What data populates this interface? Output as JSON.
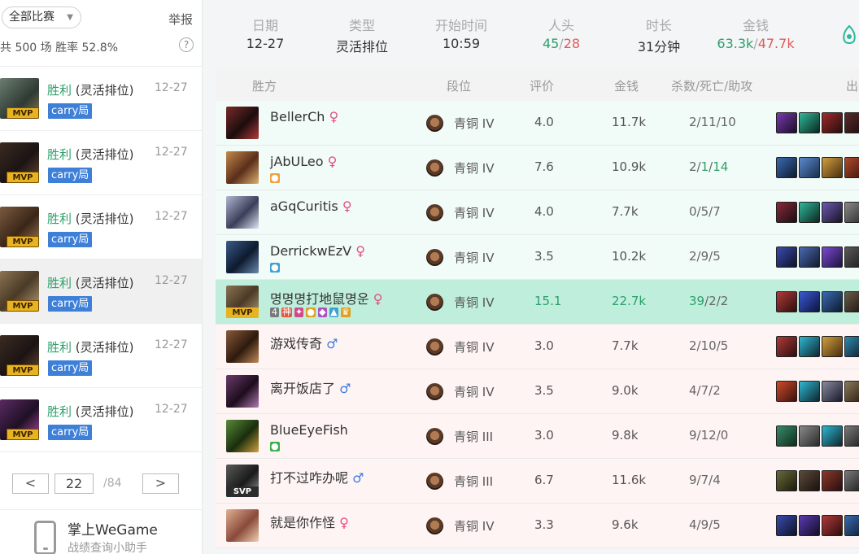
{
  "sidebar": {
    "filter_label": "全部比赛",
    "report_label": "举报",
    "summary": "共 500 场   胜率 52.8%",
    "help": "?",
    "matches": [
      {
        "result": "胜利",
        "mode": "(灵活排位)",
        "date": "12-27",
        "tag": "carry局",
        "badge": "MVP"
      },
      {
        "result": "胜利",
        "mode": "(灵活排位)",
        "date": "12-27",
        "tag": "carry局",
        "badge": "MVP"
      },
      {
        "result": "胜利",
        "mode": "(灵活排位)",
        "date": "12-27",
        "tag": "carry局",
        "badge": "MVP"
      },
      {
        "result": "胜利",
        "mode": "(灵活排位)",
        "date": "12-27",
        "tag": "carry局",
        "badge": "MVP"
      },
      {
        "result": "胜利",
        "mode": "(灵活排位)",
        "date": "12-27",
        "tag": "carry局",
        "badge": "MVP"
      },
      {
        "result": "胜利",
        "mode": "(灵活排位)",
        "date": "12-27",
        "tag": "carry局",
        "badge": "MVP"
      }
    ],
    "pager": {
      "prev": "<",
      "current": "22",
      "total": "/84",
      "next": ">"
    },
    "promo": {
      "title": "掌上WeGame",
      "subtitle": "战绩查询小助手"
    }
  },
  "stats": {
    "date_label": "日期",
    "date": "12-27",
    "type_label": "类型",
    "type": "灵活排位",
    "start_label": "开始时间",
    "start": "10:59",
    "kills_label": "人头",
    "kills_win": "45",
    "kills_sep": "/",
    "kills_lose": "28",
    "duration_label": "时长",
    "duration": "31分钟",
    "gold_label": "金钱",
    "gold_win": "63.3k",
    "gold_sep": "/",
    "gold_lose": "47.7k"
  },
  "table": {
    "headers": {
      "side": "胜方",
      "rank": "段位",
      "score": "评价",
      "gold": "金钱",
      "kda": "杀数/死亡/助攻",
      "items": "出装"
    },
    "players": [
      {
        "name": "BellerCh",
        "sex": "♀",
        "sex_type": "f",
        "rank": "青铜 IV",
        "score": "4.0",
        "gold": "11.7k",
        "k": "2",
        "d": "11",
        "a": "10"
      },
      {
        "name": "jAbULeo",
        "sex": "♀",
        "sex_type": "f",
        "rank": "青铜 IV",
        "score": "7.6",
        "gold": "10.9k",
        "k": "2",
        "d": "1",
        "a": "14"
      },
      {
        "name": "aGqCuritis",
        "sex": "♀",
        "sex_type": "f",
        "rank": "青铜 IV",
        "score": "4.0",
        "gold": "7.7k",
        "k": "0",
        "d": "5",
        "a": "7"
      },
      {
        "name": "DerrickwEzV",
        "sex": "♀",
        "sex_type": "f",
        "rank": "青铜 IV",
        "score": "3.5",
        "gold": "10.2k",
        "k": "2",
        "d": "9",
        "a": "5"
      },
      {
        "name": "명명명打地鼠명운",
        "sex": "♀",
        "sex_type": "f",
        "rank": "青铜 IV",
        "score": "15.1",
        "gold": "22.7k",
        "k": "39",
        "d": "2",
        "a": "2",
        "badge": "MVP",
        "tag1": "4",
        "tag2": "神"
      },
      {
        "name": "游戏传奇",
        "sex": "♂",
        "sex_type": "m",
        "rank": "青铜 IV",
        "score": "3.0",
        "gold": "7.7k",
        "k": "2",
        "d": "10",
        "a": "5"
      },
      {
        "name": "离开饭店了",
        "sex": "♂",
        "sex_type": "m",
        "rank": "青铜 IV",
        "score": "3.5",
        "gold": "9.0k",
        "k": "4",
        "d": "7",
        "a": "2"
      },
      {
        "name": "BlueEyeFish",
        "sex": "",
        "sex_type": "f",
        "rank": "青铜 III",
        "score": "3.0",
        "gold": "9.8k",
        "k": "9",
        "d": "12",
        "a": "0"
      },
      {
        "name": "打不过咋办呢",
        "sex": "♂",
        "sex_type": "m",
        "rank": "青铜 III",
        "score": "6.7",
        "gold": "11.6k",
        "k": "9",
        "d": "7",
        "a": "4",
        "badge": "SVP"
      },
      {
        "name": "就是你作怪",
        "sex": "♀",
        "sex_type": "f",
        "rank": "青铜 IV",
        "score": "3.3",
        "gold": "9.6k",
        "k": "4",
        "d": "9",
        "a": "5"
      }
    ]
  }
}
